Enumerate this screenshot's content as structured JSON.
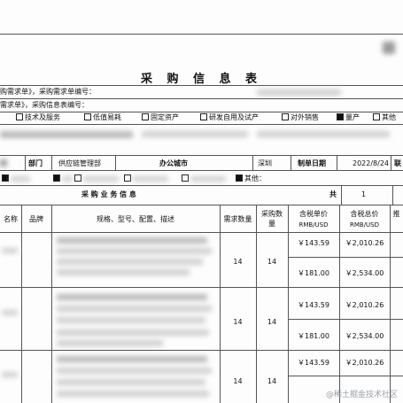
{
  "header": {
    "title": "采 购 信 息 表",
    "line1": "购需求单》，采购需求单编号：",
    "line2": "需求单》，采购信息表编号："
  },
  "categories": [
    {
      "label": "技术及服务",
      "checked": false
    },
    {
      "label": "低值易耗",
      "checked": false
    },
    {
      "label": "固定资产",
      "checked": false
    },
    {
      "label": "研发自用及试产",
      "checked": false
    },
    {
      "label": "对外销售",
      "checked": false
    },
    {
      "label": "量产",
      "checked": true
    },
    {
      "label": "其他",
      "checked": false
    }
  ],
  "info_row": {
    "dept_label": "部门",
    "dept_value": "供应链管理部",
    "city_label": "办公城市",
    "city_value": "深圳",
    "date_label": "制单日期",
    "date_value": "2022/8/24",
    "right_label": "联"
  },
  "option_row": {
    "other_label": "其他：",
    "other_checked": true
  },
  "business": {
    "section_title": "采 购 业 务 信 息",
    "total_label": "共",
    "total_value": "1"
  },
  "table": {
    "columns": [
      "名称",
      "品牌",
      "规格、型号、配置、描述",
      "需求数量",
      "采购数量",
      "含税单价\nRMB/USD",
      "含税总价\nRMB/USD",
      "推"
    ],
    "rows": [
      {
        "need": "14",
        "buy": "14",
        "unit": "￥143.59",
        "total": "￥2,010.26"
      },
      {
        "need": "",
        "buy": "",
        "unit": "￥181.00",
        "total": "￥2,534.00"
      },
      {
        "need": "14",
        "buy": "14",
        "unit": "￥143.59",
        "total": "￥2,010.26"
      },
      {
        "need": "",
        "buy": "",
        "unit": "￥181.00",
        "total": "￥2,534.00"
      },
      {
        "need": "14",
        "buy": "14",
        "unit": "￥143.59",
        "total": "￥2,010.26"
      }
    ]
  },
  "watermark": "@稀土掘金技术社区"
}
